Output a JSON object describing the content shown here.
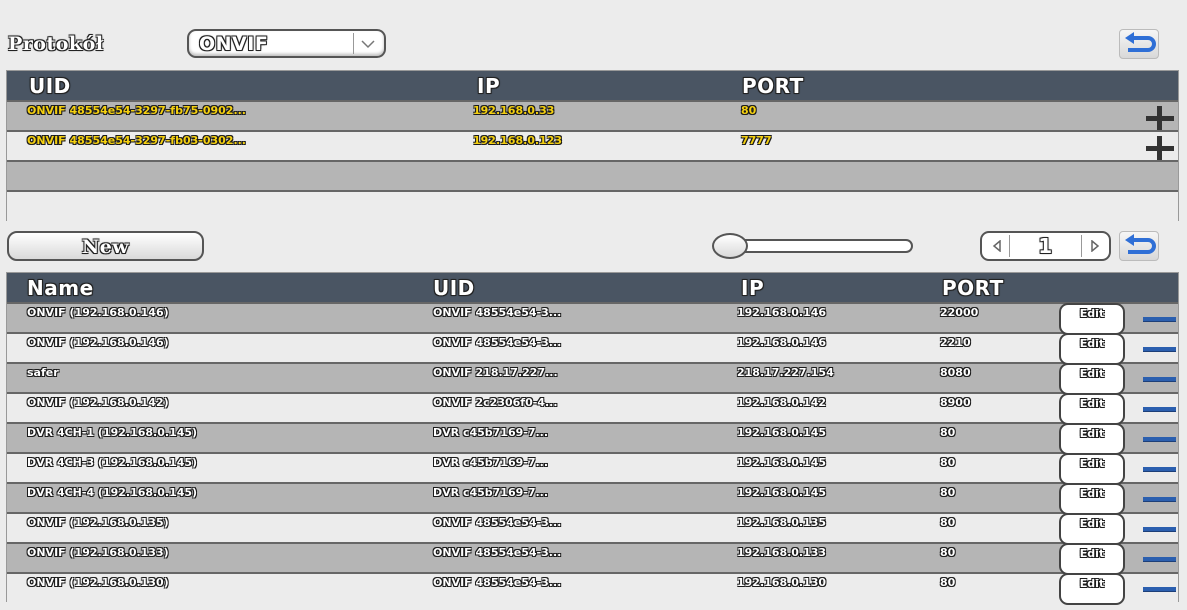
{
  "protocol": {
    "label": "Protokół",
    "selected": "ONVIF"
  },
  "discovered": {
    "headers": {
      "uid": "UID",
      "ip": "IP",
      "port": "PORT"
    },
    "rows": [
      {
        "uid": "ONVIF 48554e54-3297-fb75-0902...",
        "ip": "192.168.0.33",
        "port": "80"
      },
      {
        "uid": "ONVIF 48554e54-3297-fb03-0302...",
        "ip": "192.168.0.123",
        "port": "7777"
      }
    ]
  },
  "controls": {
    "new_label": "New",
    "page": "1"
  },
  "devices": {
    "headers": {
      "name": "Name",
      "uid": "UID",
      "ip": "IP",
      "port": "PORT"
    },
    "edit_label": "Edit",
    "rows": [
      {
        "name": "ONVIF (192.168.0.146)",
        "uid": "ONVIF 48554e54-3...",
        "ip": "192.168.0.146",
        "port": "22000"
      },
      {
        "name": "ONVIF (192.168.0.146)",
        "uid": "ONVIF 48554e54-3...",
        "ip": "192.168.0.146",
        "port": "2210"
      },
      {
        "name": "safer",
        "uid": "ONVIF 218.17.227...",
        "ip": "218.17.227.154",
        "port": "8080"
      },
      {
        "name": "ONVIF (192.168.0.142)",
        "uid": "ONVIF 2c2306f0-4...",
        "ip": "192.168.0.142",
        "port": "8900"
      },
      {
        "name": "DVR 4CH-1 (192.168.0.145)",
        "uid": "DVR c45b7169-7...",
        "ip": "192.168.0.145",
        "port": "80"
      },
      {
        "name": "DVR 4CH-3 (192.168.0.145)",
        "uid": "DVR c45b7169-7...",
        "ip": "192.168.0.145",
        "port": "80"
      },
      {
        "name": "DVR 4CH-4 (192.168.0.145)",
        "uid": "DVR c45b7169-7...",
        "ip": "192.168.0.145",
        "port": "80"
      },
      {
        "name": "ONVIF (192.168.0.135)",
        "uid": "ONVIF 48554e54-3...",
        "ip": "192.168.0.135",
        "port": "80"
      },
      {
        "name": "ONVIF (192.168.0.133)",
        "uid": "ONVIF 48554e54-3...",
        "ip": "192.168.0.133",
        "port": "80"
      },
      {
        "name": "ONVIF (192.168.0.130)",
        "uid": "ONVIF 48554e54-3...",
        "ip": "192.168.0.130",
        "port": "80"
      }
    ]
  },
  "colors": {
    "header_bg": "#4a5563",
    "highlight_text": "#f5d010",
    "minus_blue": "#2b5faf",
    "back_blue": "#2f6fd6"
  }
}
